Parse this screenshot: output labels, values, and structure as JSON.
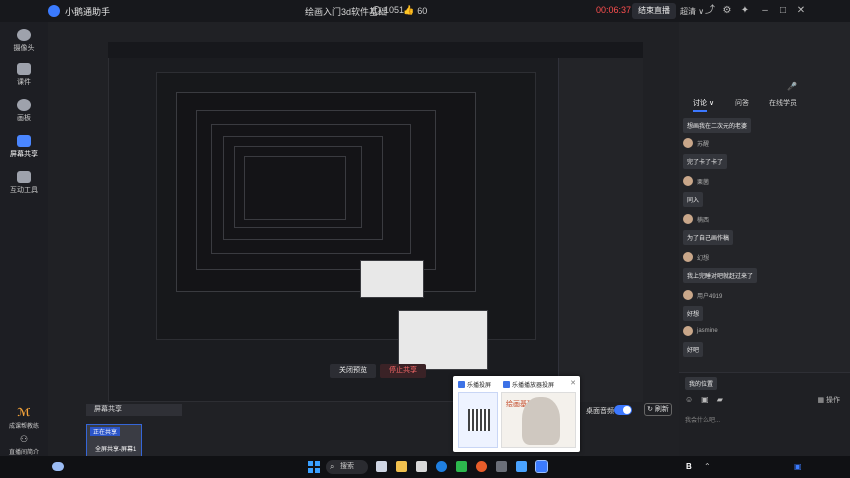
{
  "app": {
    "name": "小鹅通助手"
  },
  "header": {
    "course_title": "绘画入门3d软件基础",
    "viewers": "1051",
    "likes": "60",
    "timer": "00:06:37",
    "end_button": "结束直播",
    "quality": "超清 ∨",
    "icons": [
      "share-icon",
      "settings-icon",
      "pin-icon",
      "minimize-icon",
      "maximize-icon",
      "close-icon"
    ]
  },
  "sidebar": {
    "items": [
      {
        "label": "摄像头",
        "icon": "camera-icon",
        "active": false
      },
      {
        "label": "课件",
        "icon": "courseware-icon",
        "active": false
      },
      {
        "label": "画板",
        "icon": "palette-icon",
        "active": false
      },
      {
        "label": "屏幕共享",
        "icon": "screen-share-icon",
        "active": true
      },
      {
        "label": "互动工具",
        "icon": "toolbox-icon",
        "active": false
      }
    ],
    "bottom": [
      {
        "label": "成课帮教练",
        "icon": "coach-icon"
      },
      {
        "label": "直播间简介",
        "icon": "intro-icon"
      }
    ]
  },
  "stage": {
    "share_label": "屏幕共享",
    "share_tag": "正在共享",
    "share_sub": "全屏共享-屏幕1",
    "close_preview": "关闭预览",
    "stop_share": "停止共享",
    "desktop_audio": "桌面音频",
    "refresh": "刷新"
  },
  "popup": {
    "tab1": "乐播投屏",
    "tab2": "乐播播放器投屏",
    "art_text": "绘画基础"
  },
  "chat": {
    "tabs": [
      "讨论 ∨",
      "问答",
      "在线学员"
    ],
    "messages": [
      {
        "user": "",
        "text": "想画我在二次元的老婆"
      },
      {
        "user": "苏醒",
        "text": "完了卡了卡了"
      },
      {
        "user": "栗菌",
        "text": "同入"
      },
      {
        "user": "楠西",
        "text": "为了自己画作稿"
      },
      {
        "user": "幻想",
        "text": "我上完睡对吧就赶过来了"
      },
      {
        "user": "用户4919",
        "text": "好想"
      },
      {
        "user": "jasmine",
        "text": "好吧"
      }
    ],
    "my_position": "我的位置",
    "operations": "操作",
    "input_placeholder": "我会什么吧..."
  },
  "taskbar": {
    "search": "搜索"
  }
}
